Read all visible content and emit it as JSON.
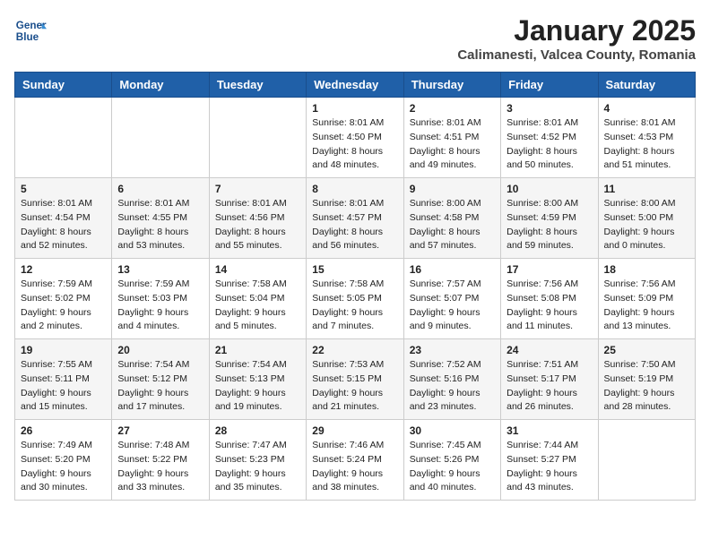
{
  "header": {
    "logo_line1": "General",
    "logo_line2": "Blue",
    "month": "January 2025",
    "location": "Calimanesti, Valcea County, Romania"
  },
  "weekdays": [
    "Sunday",
    "Monday",
    "Tuesday",
    "Wednesday",
    "Thursday",
    "Friday",
    "Saturday"
  ],
  "weeks": [
    [
      {
        "day": "",
        "sunrise": "",
        "sunset": "",
        "daylight": ""
      },
      {
        "day": "",
        "sunrise": "",
        "sunset": "",
        "daylight": ""
      },
      {
        "day": "",
        "sunrise": "",
        "sunset": "",
        "daylight": ""
      },
      {
        "day": "1",
        "sunrise": "Sunrise: 8:01 AM",
        "sunset": "Sunset: 4:50 PM",
        "daylight": "Daylight: 8 hours and 48 minutes."
      },
      {
        "day": "2",
        "sunrise": "Sunrise: 8:01 AM",
        "sunset": "Sunset: 4:51 PM",
        "daylight": "Daylight: 8 hours and 49 minutes."
      },
      {
        "day": "3",
        "sunrise": "Sunrise: 8:01 AM",
        "sunset": "Sunset: 4:52 PM",
        "daylight": "Daylight: 8 hours and 50 minutes."
      },
      {
        "day": "4",
        "sunrise": "Sunrise: 8:01 AM",
        "sunset": "Sunset: 4:53 PM",
        "daylight": "Daylight: 8 hours and 51 minutes."
      }
    ],
    [
      {
        "day": "5",
        "sunrise": "Sunrise: 8:01 AM",
        "sunset": "Sunset: 4:54 PM",
        "daylight": "Daylight: 8 hours and 52 minutes."
      },
      {
        "day": "6",
        "sunrise": "Sunrise: 8:01 AM",
        "sunset": "Sunset: 4:55 PM",
        "daylight": "Daylight: 8 hours and 53 minutes."
      },
      {
        "day": "7",
        "sunrise": "Sunrise: 8:01 AM",
        "sunset": "Sunset: 4:56 PM",
        "daylight": "Daylight: 8 hours and 55 minutes."
      },
      {
        "day": "8",
        "sunrise": "Sunrise: 8:01 AM",
        "sunset": "Sunset: 4:57 PM",
        "daylight": "Daylight: 8 hours and 56 minutes."
      },
      {
        "day": "9",
        "sunrise": "Sunrise: 8:00 AM",
        "sunset": "Sunset: 4:58 PM",
        "daylight": "Daylight: 8 hours and 57 minutes."
      },
      {
        "day": "10",
        "sunrise": "Sunrise: 8:00 AM",
        "sunset": "Sunset: 4:59 PM",
        "daylight": "Daylight: 8 hours and 59 minutes."
      },
      {
        "day": "11",
        "sunrise": "Sunrise: 8:00 AM",
        "sunset": "Sunset: 5:00 PM",
        "daylight": "Daylight: 9 hours and 0 minutes."
      }
    ],
    [
      {
        "day": "12",
        "sunrise": "Sunrise: 7:59 AM",
        "sunset": "Sunset: 5:02 PM",
        "daylight": "Daylight: 9 hours and 2 minutes."
      },
      {
        "day": "13",
        "sunrise": "Sunrise: 7:59 AM",
        "sunset": "Sunset: 5:03 PM",
        "daylight": "Daylight: 9 hours and 4 minutes."
      },
      {
        "day": "14",
        "sunrise": "Sunrise: 7:58 AM",
        "sunset": "Sunset: 5:04 PM",
        "daylight": "Daylight: 9 hours and 5 minutes."
      },
      {
        "day": "15",
        "sunrise": "Sunrise: 7:58 AM",
        "sunset": "Sunset: 5:05 PM",
        "daylight": "Daylight: 9 hours and 7 minutes."
      },
      {
        "day": "16",
        "sunrise": "Sunrise: 7:57 AM",
        "sunset": "Sunset: 5:07 PM",
        "daylight": "Daylight: 9 hours and 9 minutes."
      },
      {
        "day": "17",
        "sunrise": "Sunrise: 7:56 AM",
        "sunset": "Sunset: 5:08 PM",
        "daylight": "Daylight: 9 hours and 11 minutes."
      },
      {
        "day": "18",
        "sunrise": "Sunrise: 7:56 AM",
        "sunset": "Sunset: 5:09 PM",
        "daylight": "Daylight: 9 hours and 13 minutes."
      }
    ],
    [
      {
        "day": "19",
        "sunrise": "Sunrise: 7:55 AM",
        "sunset": "Sunset: 5:11 PM",
        "daylight": "Daylight: 9 hours and 15 minutes."
      },
      {
        "day": "20",
        "sunrise": "Sunrise: 7:54 AM",
        "sunset": "Sunset: 5:12 PM",
        "daylight": "Daylight: 9 hours and 17 minutes."
      },
      {
        "day": "21",
        "sunrise": "Sunrise: 7:54 AM",
        "sunset": "Sunset: 5:13 PM",
        "daylight": "Daylight: 9 hours and 19 minutes."
      },
      {
        "day": "22",
        "sunrise": "Sunrise: 7:53 AM",
        "sunset": "Sunset: 5:15 PM",
        "daylight": "Daylight: 9 hours and 21 minutes."
      },
      {
        "day": "23",
        "sunrise": "Sunrise: 7:52 AM",
        "sunset": "Sunset: 5:16 PM",
        "daylight": "Daylight: 9 hours and 23 minutes."
      },
      {
        "day": "24",
        "sunrise": "Sunrise: 7:51 AM",
        "sunset": "Sunset: 5:17 PM",
        "daylight": "Daylight: 9 hours and 26 minutes."
      },
      {
        "day": "25",
        "sunrise": "Sunrise: 7:50 AM",
        "sunset": "Sunset: 5:19 PM",
        "daylight": "Daylight: 9 hours and 28 minutes."
      }
    ],
    [
      {
        "day": "26",
        "sunrise": "Sunrise: 7:49 AM",
        "sunset": "Sunset: 5:20 PM",
        "daylight": "Daylight: 9 hours and 30 minutes."
      },
      {
        "day": "27",
        "sunrise": "Sunrise: 7:48 AM",
        "sunset": "Sunset: 5:22 PM",
        "daylight": "Daylight: 9 hours and 33 minutes."
      },
      {
        "day": "28",
        "sunrise": "Sunrise: 7:47 AM",
        "sunset": "Sunset: 5:23 PM",
        "daylight": "Daylight: 9 hours and 35 minutes."
      },
      {
        "day": "29",
        "sunrise": "Sunrise: 7:46 AM",
        "sunset": "Sunset: 5:24 PM",
        "daylight": "Daylight: 9 hours and 38 minutes."
      },
      {
        "day": "30",
        "sunrise": "Sunrise: 7:45 AM",
        "sunset": "Sunset: 5:26 PM",
        "daylight": "Daylight: 9 hours and 40 minutes."
      },
      {
        "day": "31",
        "sunrise": "Sunrise: 7:44 AM",
        "sunset": "Sunset: 5:27 PM",
        "daylight": "Daylight: 9 hours and 43 minutes."
      },
      {
        "day": "",
        "sunrise": "",
        "sunset": "",
        "daylight": ""
      }
    ]
  ]
}
